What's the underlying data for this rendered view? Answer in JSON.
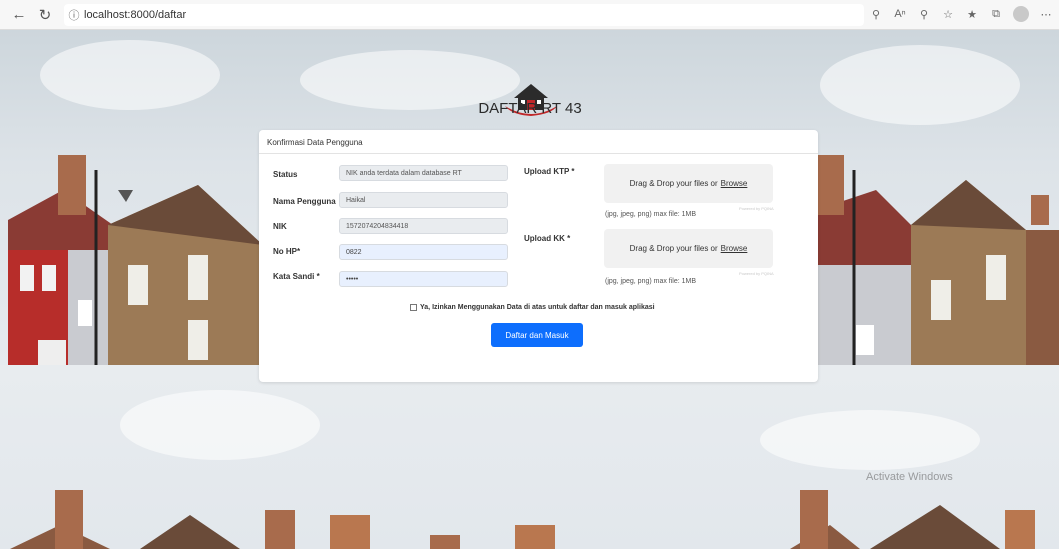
{
  "browser": {
    "back_icon": "arrow-left-icon",
    "reload_icon": "refresh-icon",
    "info_icon": "info-icon",
    "url": "localhost:8000/daftar",
    "toolbar_icons": [
      "read-aloud-icon",
      "text-size-icon",
      "zoom-icon",
      "favorite-icon",
      "favorites-list-icon",
      "collections-icon",
      "profile-icon",
      "more-icon"
    ]
  },
  "header": {
    "title": "DAFTAR RT 43",
    "logo_icon": "house-logo-icon"
  },
  "card": {
    "title": "Konfirmasi Data Pengguna",
    "fields": {
      "status": {
        "label": "Status",
        "value": "NIK anda terdata dalam database RT"
      },
      "nama": {
        "label": "Nama Pengguna",
        "value": "Haikal"
      },
      "nik": {
        "label": "NIK",
        "value": "1572074204834418"
      },
      "hp": {
        "label": "No HP*",
        "value": "0822"
      },
      "sandi": {
        "label": "Kata Sandi *",
        "value": "•••••"
      }
    },
    "upload_ktp": {
      "label": "Upload KTP *",
      "drop_text": "Drag & Drop your files or",
      "browse": "Browse",
      "powered": "Powered by PQINA",
      "hint": "(jpg, jpeg, png) max file: 1MB"
    },
    "upload_kk": {
      "label": "Upload KK *",
      "drop_text": "Drag & Drop your files or",
      "browse": "Browse",
      "powered": "Powered by PQINA",
      "hint": "(jpg, jpeg, png) max file: 1MB"
    },
    "consent": "Ya, Izinkan Menggunakan Data di atas untuk daftar dan masuk aplikasi",
    "submit": "Daftar dan Masuk"
  },
  "watermark": "Activate Windows",
  "colors": {
    "primary": "#0d6efd",
    "logo_red": "#c0282a",
    "logo_dark": "#2b2b2b"
  }
}
